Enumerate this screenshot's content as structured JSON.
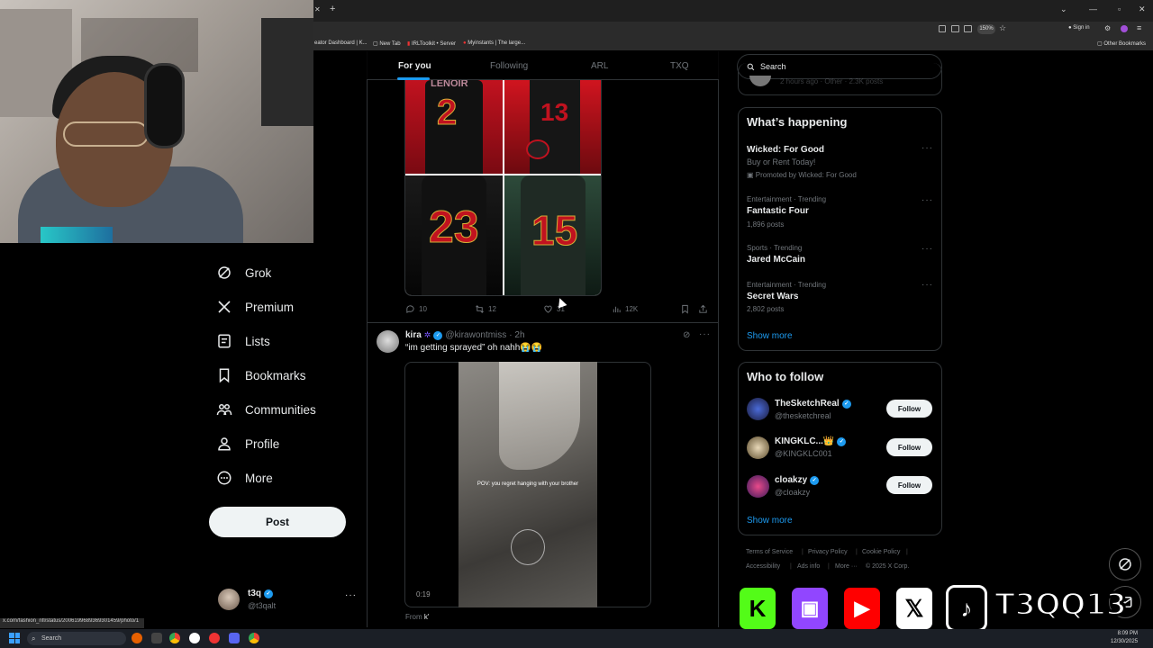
{
  "browser": {
    "zoom": "150%",
    "sign_in": "Sign in",
    "bookmarks": [
      "eator Dashboard | K...",
      "New Tab",
      "IRLToolkit • Server",
      "Myinstants | The large...",
      "Other Bookmarks"
    ],
    "status_url": "x.com/fashion_nfl/status/2006199689369301459/photo/1"
  },
  "nav": {
    "items": [
      {
        "label": "Grok",
        "icon": "grok-icon"
      },
      {
        "label": "Premium",
        "icon": "x-logo-icon"
      },
      {
        "label": "Lists",
        "icon": "list-icon"
      },
      {
        "label": "Bookmarks",
        "icon": "bookmark-icon"
      },
      {
        "label": "Communities",
        "icon": "communities-icon"
      },
      {
        "label": "Profile",
        "icon": "profile-icon"
      },
      {
        "label": "More",
        "icon": "more-circle-icon"
      }
    ],
    "post_label": "Post",
    "account": {
      "name": "t3q",
      "handle": "@t3qalt"
    }
  },
  "tabs": [
    "For you",
    "Following",
    "ARL",
    "TXQ"
  ],
  "tweet1": {
    "jersey_numbers": [
      "2",
      "13",
      "23",
      "15"
    ],
    "header_text": "LENOIR",
    "replies": "10",
    "reposts": "12",
    "likes": "31",
    "views": "12K"
  },
  "tweet2": {
    "name": "kira",
    "handle": "@kirawontmiss",
    "time": "· 2h",
    "text": "“im getting sprayed” oh nahh😭😭",
    "video_caption": "POV: you regret hanging with your brother",
    "video_time": "0:19",
    "from_label": "From",
    "from_source": "k'"
  },
  "search": {
    "placeholder": "Search"
  },
  "cropped_meta": "2 hours ago · Other · 2.3K posts",
  "whats_happening": {
    "title": "What’s happening",
    "promo": {
      "name": "Wicked: For Good",
      "sub": "Buy or Rent Today!",
      "promoted": "Promoted by Wicked: For Good"
    },
    "trends": [
      {
        "meta": "Entertainment · Trending",
        "name": "Fantastic Four",
        "posts": "1,896 posts"
      },
      {
        "meta": "Sports · Trending",
        "name": "Jared McCain",
        "posts": ""
      },
      {
        "meta": "Entertainment · Trending",
        "name": "Secret Wars",
        "posts": "2,802 posts"
      }
    ],
    "show_more": "Show more"
  },
  "who_to_follow": {
    "title": "Who to follow",
    "users": [
      {
        "name": "TheSketchReal",
        "handle": "@thesketchreal",
        "button": "Follow"
      },
      {
        "name": "KINGKLC...👑",
        "handle": "@KINGKLC001",
        "button": "Follow"
      },
      {
        "name": "cloakzy",
        "handle": "@cloakzy",
        "button": "Follow"
      }
    ],
    "show_more": "Show more"
  },
  "footer": [
    "Terms of Service",
    "Privacy Policy",
    "Cookie Policy",
    "Accessibility",
    "Ads info",
    "More ···",
    "© 2025 X Corp."
  ],
  "overlay": {
    "brand": "T3QQ13"
  },
  "taskbar": {
    "search": "Search",
    "time": "8:09 PM",
    "date": "12/30/2025"
  },
  "colors": {
    "accent": "#1d9bf0",
    "bg": "#000000",
    "border": "#2f3336",
    "muted": "#71767b"
  }
}
